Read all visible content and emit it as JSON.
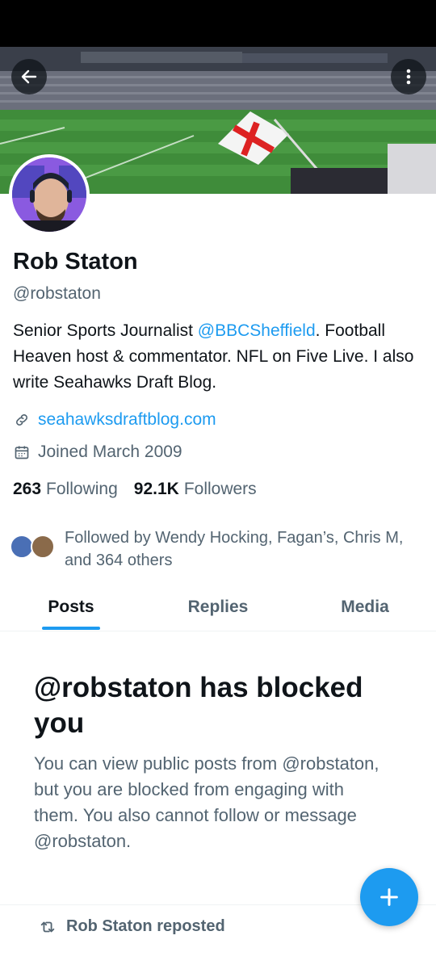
{
  "profile": {
    "name": "Rob Staton",
    "handle": "@robstaton",
    "bio_prefix": "Senior Sports Journalist ",
    "bio_mention": "@BBCSheffield",
    "bio_suffix": ". Football Heaven host & commentator. NFL on Five Live. I also write Seahawks Draft Blog.",
    "website": "seahawksdraftblog.com",
    "joined": "Joined March 2009"
  },
  "stats": {
    "following_count": "263",
    "following_label": "Following",
    "followers_count": "92.1K",
    "followers_label": "Followers"
  },
  "followed_by": {
    "text": "Followed by Wendy Hocking, Fagan’s, Chris M, and 364 others"
  },
  "tabs": [
    {
      "label": "Posts",
      "active": true
    },
    {
      "label": "Replies",
      "active": false
    },
    {
      "label": "Media",
      "active": false
    }
  ],
  "blocked": {
    "title": "@robstaton has blocked you",
    "description": "You can view public posts from @robstaton, but you are blocked from engaging with them. You also cannot follow or message @robstaton."
  },
  "repost": {
    "label": "Rob Staton reposted"
  },
  "icons": {
    "back": "arrow-left-icon",
    "more": "more-vertical-icon",
    "link": "link-icon",
    "calendar": "calendar-icon",
    "repost": "repost-icon",
    "compose": "plus-icon"
  },
  "colors": {
    "accent": "#1d9bf0",
    "text_primary": "#0f1419",
    "text_secondary": "#536471"
  }
}
